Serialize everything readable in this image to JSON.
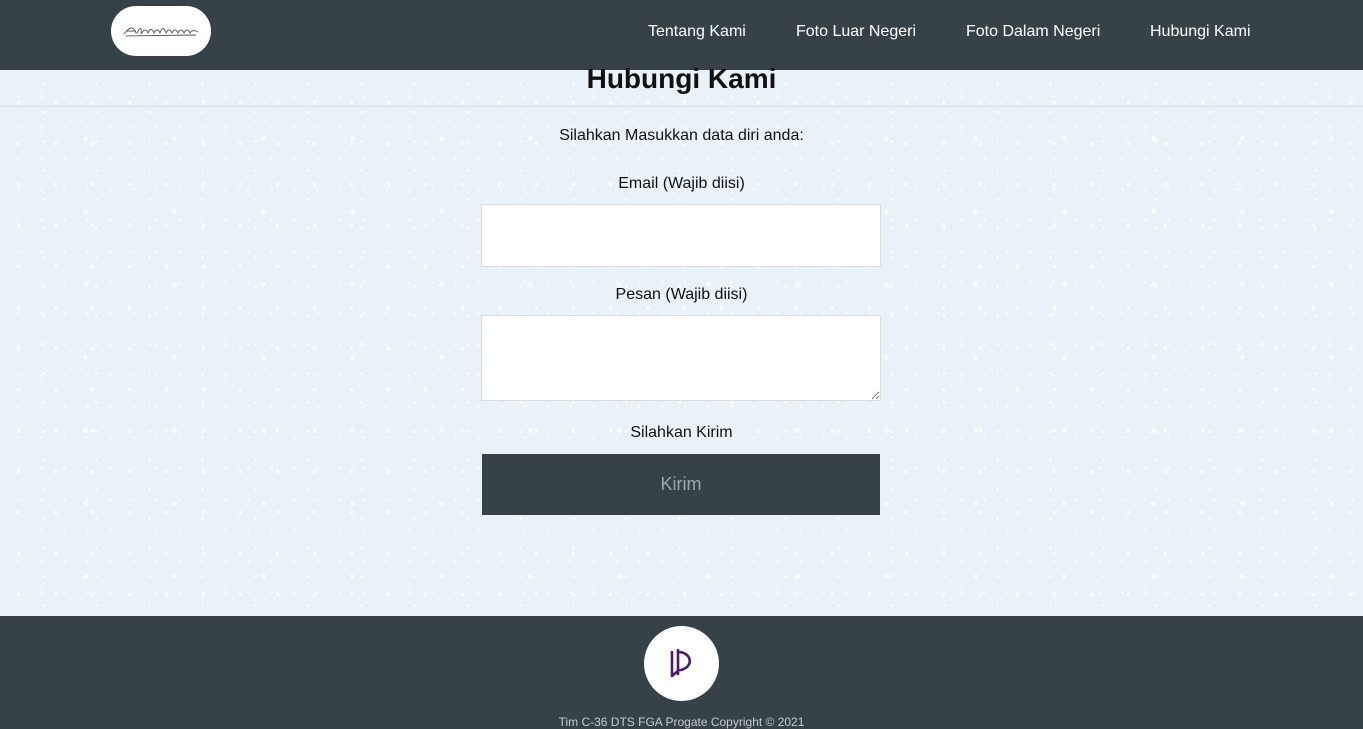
{
  "brand": {
    "logo_text": "Adventure"
  },
  "nav": {
    "items": [
      {
        "label": "Tentang Kami"
      },
      {
        "label": "Foto Luar Negeri"
      },
      {
        "label": "Foto Dalam Negeri"
      },
      {
        "label": "Hubungi Kami"
      }
    ]
  },
  "contact": {
    "title": "Hubungi Kami",
    "intro": "Silahkan Masukkan data diri anda:",
    "email_label": "Email (Wajib diisi)",
    "email_value": "",
    "message_label": "Pesan (Wajib diisi)",
    "message_value": "",
    "submit_prompt": "Silahkan Kirim",
    "submit_label": "Kirim"
  },
  "footer": {
    "logo_icon": "progate-icon",
    "copyright": "Tim C-36 DTS FGA Progate Copyright © 2021"
  },
  "colors": {
    "nav_background": "#364247",
    "page_background": "#e8f2f8",
    "footer_logo": "#4a1a6b"
  }
}
